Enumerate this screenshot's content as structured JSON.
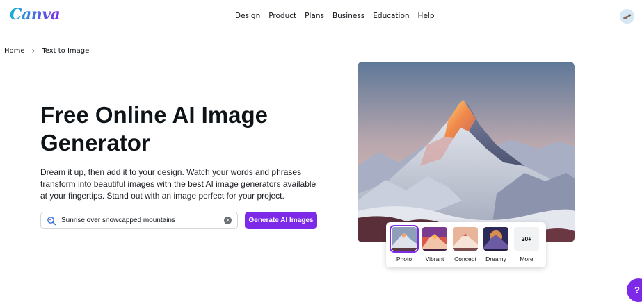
{
  "header": {
    "logo": "Canva",
    "nav": [
      "Design",
      "Product",
      "Plans",
      "Business",
      "Education",
      "Help"
    ],
    "avatar_icon": "user-avatar"
  },
  "breadcrumb": {
    "home": "Home",
    "current": "Text to Image"
  },
  "hero": {
    "title": "Free Online AI Image Generator",
    "description": "Dream it up, then add it to your design. Watch your words and phrases transform into beautiful images with the best AI image generators available at your fingertips. Stand out with an image perfect for your project.",
    "search_value": "Sunrise over snowcapped mountains",
    "generate_label": "Generate AI Images"
  },
  "styles": {
    "options": [
      "Photo",
      "Vibrant",
      "Concept",
      "Dreamy"
    ],
    "selected": "Photo",
    "more_count": "20+",
    "more_label": "More"
  },
  "help": {
    "label": "?"
  },
  "colors": {
    "brand_purple": "#7d2ae8",
    "logo_teal": "#0fb3d6"
  }
}
